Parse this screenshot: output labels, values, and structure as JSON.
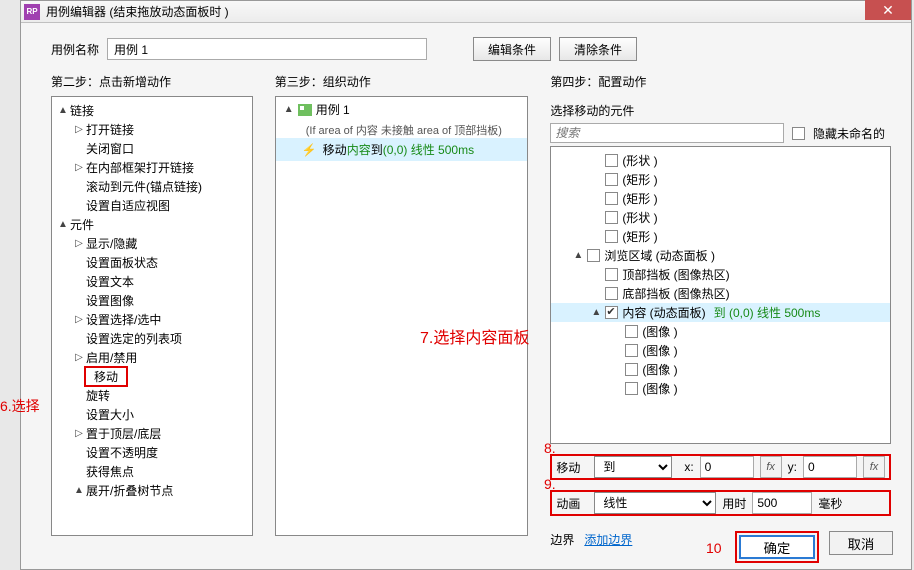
{
  "window": {
    "title": "用例编辑器 (结束拖放动态面板时 )",
    "icon_text": "RP"
  },
  "name_row": {
    "label": "用例名称",
    "value": "用例 1",
    "edit_cond_btn": "编辑条件",
    "clear_cond_btn": "清除条件"
  },
  "steps": {
    "s2": "第二步：点击新增动作",
    "s3": "第三步：组织动作",
    "s4": "第四步：配置动作"
  },
  "actions_tree": {
    "groups": [
      {
        "label": "链接",
        "exp": "▲",
        "items": [
          {
            "label": "打开链接",
            "exp": "▷"
          },
          {
            "label": "关闭窗口",
            "exp": ""
          },
          {
            "label": "在内部框架打开链接",
            "exp": "▷"
          },
          {
            "label": "滚动到元件(锚点链接)",
            "exp": ""
          },
          {
            "label": "设置自适应视图",
            "exp": ""
          }
        ]
      },
      {
        "label": "元件",
        "exp": "▲",
        "items": [
          {
            "label": "显示/隐藏",
            "exp": "▷"
          },
          {
            "label": "设置面板状态",
            "exp": ""
          },
          {
            "label": "设置文本",
            "exp": ""
          },
          {
            "label": "设置图像",
            "exp": ""
          },
          {
            "label": "设置选择/选中",
            "exp": "▷"
          },
          {
            "label": "设置选定的列表项",
            "exp": ""
          },
          {
            "label": "启用/禁用",
            "exp": "▷"
          },
          {
            "label": "移动",
            "exp": "",
            "hl": true
          },
          {
            "label": "旋转",
            "exp": ""
          },
          {
            "label": "设置大小",
            "exp": ""
          },
          {
            "label": "置于顶层/底层",
            "exp": "▷"
          },
          {
            "label": "设置不透明度",
            "exp": ""
          },
          {
            "label": "获得焦点",
            "exp": ""
          },
          {
            "label": "展开/折叠树节点",
            "exp": "▲"
          }
        ]
      }
    ]
  },
  "case_panel": {
    "case_name": "用例 1",
    "condition": "(If area of 内容 未接触  area of 顶部挡板)",
    "action_prefix": "移动 ",
    "action_target": "内容",
    "action_mid": " 到 ",
    "action_coord": "(0,0)  线性  500ms"
  },
  "config": {
    "title": "选择移动的元件",
    "search_placeholder": "搜索",
    "hide_unnamed": "隐藏未命名的",
    "widgets": [
      {
        "indent": 2,
        "label": "(形状 )",
        "exp": ""
      },
      {
        "indent": 2,
        "label": "(矩形 )",
        "exp": ""
      },
      {
        "indent": 2,
        "label": "(矩形 )",
        "exp": ""
      },
      {
        "indent": 2,
        "label": "(形状 )",
        "exp": ""
      },
      {
        "indent": 2,
        "label": "(矩形 )",
        "exp": ""
      },
      {
        "indent": 1,
        "label": "浏览区域 (动态面板 )",
        "exp": "▲",
        "check": false
      },
      {
        "indent": 2,
        "label": "顶部挡板 (图像热区)",
        "exp": ""
      },
      {
        "indent": 2,
        "label": "底部挡板 (图像热区)",
        "exp": ""
      },
      {
        "indent": 2,
        "label": "内容 (动态面板)",
        "exp": "▲",
        "check": true,
        "hl": true,
        "extra": " 到 (0,0)  线性  500ms"
      },
      {
        "indent": 3,
        "label": "(图像 )",
        "exp": ""
      },
      {
        "indent": 3,
        "label": "(图像 )",
        "exp": ""
      },
      {
        "indent": 3,
        "label": "(图像 )",
        "exp": ""
      },
      {
        "indent": 3,
        "label": "(图像 )",
        "exp": ""
      }
    ],
    "move": {
      "label": "移动",
      "mode": "到",
      "x_lab": "x:",
      "x": "0",
      "y_lab": "y:",
      "y": "0",
      "fx": "fx"
    },
    "anim": {
      "label": "动画",
      "easing": "线性",
      "time_lab": "用时",
      "time": "500",
      "unit": "毫秒"
    },
    "bounds_label": "边界",
    "bounds_link": "添加边界"
  },
  "buttons": {
    "ok": "确定",
    "cancel": "取消"
  },
  "annotations": {
    "a6": "6.选择",
    "a7": "7.选择内容面板",
    "a8": "8.",
    "a9": "9.",
    "a10": "10"
  }
}
